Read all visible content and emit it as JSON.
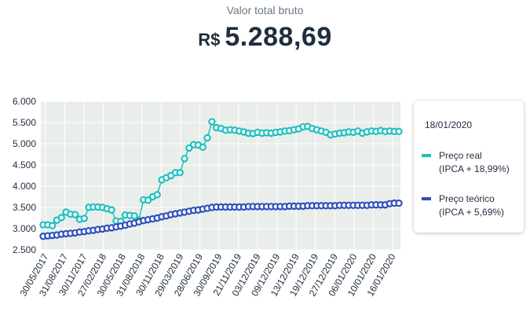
{
  "header": {
    "caption": "Valor total bruto",
    "currency": "R$",
    "amount": "5.288,69"
  },
  "legend": {
    "date": "18/01/2020",
    "items": [
      {
        "line1": "Preço real",
        "line2": "(IPCA + 18,99%)",
        "color": "#1fc0c0"
      },
      {
        "line1": "Preço teórico",
        "line2": "(IPCA + 5,69%)",
        "color": "#2f4fbf"
      }
    ]
  },
  "chart_data": {
    "type": "line",
    "ylim": [
      2500,
      6000
    ],
    "yticks": [
      "2.500",
      "3.000",
      "3.500",
      "4.000",
      "4.500",
      "5.000",
      "5.500",
      "6.000"
    ],
    "ytick_values": [
      2500,
      3000,
      3500,
      4000,
      4500,
      5000,
      5500,
      6000
    ],
    "xticks": [
      "30/05/2017",
      "31/08/2017",
      "30/11/2017",
      "27/02/2018",
      "30/05/2018",
      "31/08/2018",
      "30/11/2018",
      "29/03/2019",
      "28/06/2019",
      "30/09/2019",
      "21/11/2019",
      "03/12/2019",
      "09/12/2019",
      "13/12/2019",
      "19/12/2019",
      "27/12/2019",
      "06/01/2020",
      "10/01/2020",
      "16/01/2020"
    ],
    "grid": true,
    "series": [
      {
        "name": "Preço real",
        "color": "#1fc0c0",
        "values": [
          3090,
          3090,
          3070,
          3200,
          3260,
          3390,
          3340,
          3330,
          3220,
          3240,
          3500,
          3510,
          3510,
          3500,
          3470,
          3440,
          3180,
          3170,
          3320,
          3310,
          3300,
          3200,
          3680,
          3670,
          3750,
          3800,
          4150,
          4200,
          4250,
          4320,
          4320,
          4650,
          4900,
          4980,
          4970,
          4920,
          5140,
          5520,
          5380,
          5360,
          5320,
          5330,
          5320,
          5300,
          5280,
          5250,
          5240,
          5270,
          5250,
          5260,
          5250,
          5270,
          5280,
          5300,
          5310,
          5330,
          5350,
          5400,
          5410,
          5360,
          5330,
          5300,
          5270,
          5210,
          5230,
          5250,
          5260,
          5280,
          5270,
          5300,
          5250,
          5280,
          5300,
          5290,
          5310,
          5290,
          5300,
          5290,
          5290
        ]
      },
      {
        "name": "Preço teórico",
        "color": "#2f4fbf",
        "values": [
          2820,
          2830,
          2840,
          2850,
          2870,
          2880,
          2890,
          2900,
          2920,
          2930,
          2950,
          2960,
          2980,
          2990,
          3010,
          3020,
          3040,
          3060,
          3080,
          3110,
          3130,
          3160,
          3190,
          3210,
          3230,
          3250,
          3280,
          3300,
          3330,
          3350,
          3370,
          3390,
          3410,
          3430,
          3440,
          3460,
          3480,
          3500,
          3510,
          3510,
          3510,
          3510,
          3510,
          3510,
          3510,
          3520,
          3520,
          3520,
          3520,
          3520,
          3520,
          3520,
          3520,
          3520,
          3530,
          3530,
          3530,
          3530,
          3540,
          3540,
          3540,
          3540,
          3540,
          3540,
          3540,
          3550,
          3550,
          3550,
          3550,
          3550,
          3550,
          3550,
          3560,
          3560,
          3560,
          3560,
          3590,
          3600,
          3600
        ]
      }
    ]
  }
}
